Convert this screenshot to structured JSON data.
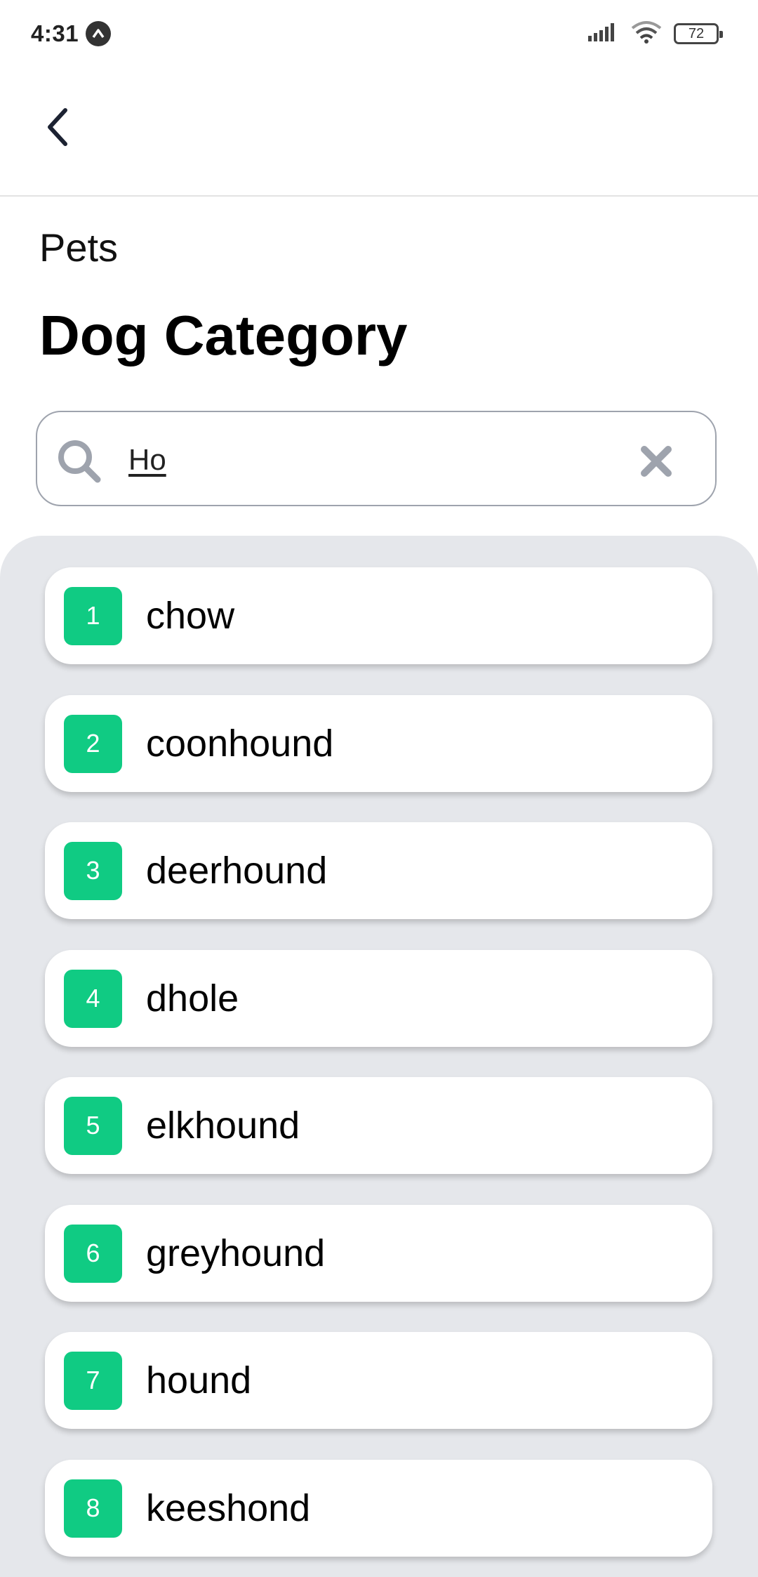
{
  "status_bar": {
    "time": "4:31",
    "app_icon": "caret-up-icon",
    "signal_icon": "cellular-signal-icon",
    "wifi_icon": "wifi-icon",
    "battery_level": "72"
  },
  "app_bar": {
    "back_icon": "chevron-left-icon"
  },
  "header": {
    "section": "Pets",
    "title": "Dog Category"
  },
  "search": {
    "value": "Ho",
    "search_icon": "search-icon",
    "clear_icon": "close-icon"
  },
  "results": [
    {
      "index": "1",
      "label": "chow"
    },
    {
      "index": "2",
      "label": "coonhound"
    },
    {
      "index": "3",
      "label": "deerhound"
    },
    {
      "index": "4",
      "label": "dhole"
    },
    {
      "index": "5",
      "label": "elkhound"
    },
    {
      "index": "6",
      "label": "greyhound"
    },
    {
      "index": "7",
      "label": "hound"
    },
    {
      "index": "8",
      "label": "keeshond"
    }
  ],
  "colors": {
    "badge": "#10cb83",
    "panel_background": "#e5e7eb",
    "icon_gray": "#9ea3ad"
  }
}
